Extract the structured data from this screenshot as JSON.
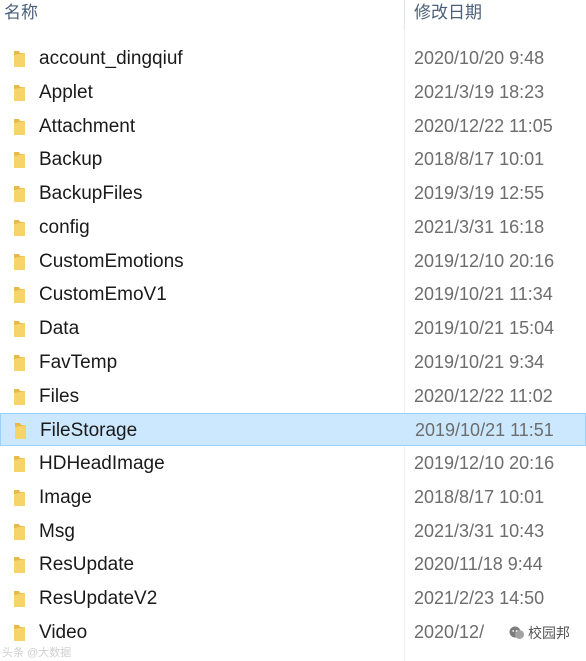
{
  "header": {
    "name_label": "名称",
    "date_label": "修改日期"
  },
  "colors": {
    "folder": "#e8b84a",
    "folder_light": "#f7d46a",
    "selected_bg": "#cce8ff",
    "selected_border": "#99d1ff"
  },
  "folders": [
    {
      "name": "account_dingqiuf",
      "modified": "2020/10/20 9:48"
    },
    {
      "name": "Applet",
      "modified": "2021/3/19 18:23"
    },
    {
      "name": "Attachment",
      "modified": "2020/12/22 11:05"
    },
    {
      "name": "Backup",
      "modified": "2018/8/17 10:01"
    },
    {
      "name": "BackupFiles",
      "modified": "2019/3/19 12:55"
    },
    {
      "name": "config",
      "modified": "2021/3/31 16:18"
    },
    {
      "name": "CustomEmotions",
      "modified": "2019/12/10 20:16"
    },
    {
      "name": "CustomEmoV1",
      "modified": "2019/10/21 11:34"
    },
    {
      "name": "Data",
      "modified": "2019/10/21 15:04"
    },
    {
      "name": "FavTemp",
      "modified": "2019/10/21 9:34"
    },
    {
      "name": "Files",
      "modified": "2020/12/22 11:02"
    },
    {
      "name": "FileStorage",
      "modified": "2019/10/21 11:51",
      "selected": true
    },
    {
      "name": "HDHeadImage",
      "modified": "2019/12/10 20:16"
    },
    {
      "name": "Image",
      "modified": "2018/8/17 10:01"
    },
    {
      "name": "Msg",
      "modified": "2021/3/31 10:43"
    },
    {
      "name": "ResUpdate",
      "modified": "2020/11/18 9:44"
    },
    {
      "name": "ResUpdateV2",
      "modified": "2021/2/23 14:50"
    },
    {
      "name": "Video",
      "modified": "2020/12/"
    }
  ],
  "watermark": {
    "right_text": "校园邦",
    "left_text": "头条 @大数据"
  }
}
